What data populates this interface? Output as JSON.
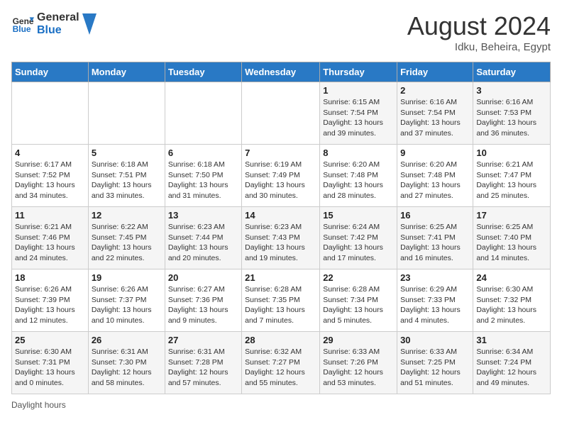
{
  "header": {
    "logo_line1": "General",
    "logo_line2": "Blue",
    "month_year": "August 2024",
    "location": "Idku, Beheira, Egypt"
  },
  "weekdays": [
    "Sunday",
    "Monday",
    "Tuesday",
    "Wednesday",
    "Thursday",
    "Friday",
    "Saturday"
  ],
  "weeks": [
    [
      {
        "day": "",
        "sunrise": "",
        "sunset": "",
        "daylight": ""
      },
      {
        "day": "",
        "sunrise": "",
        "sunset": "",
        "daylight": ""
      },
      {
        "day": "",
        "sunrise": "",
        "sunset": "",
        "daylight": ""
      },
      {
        "day": "",
        "sunrise": "",
        "sunset": "",
        "daylight": ""
      },
      {
        "day": "1",
        "sunrise": "6:15 AM",
        "sunset": "7:54 PM",
        "daylight": "13 hours and 39 minutes."
      },
      {
        "day": "2",
        "sunrise": "6:16 AM",
        "sunset": "7:54 PM",
        "daylight": "13 hours and 37 minutes."
      },
      {
        "day": "3",
        "sunrise": "6:16 AM",
        "sunset": "7:53 PM",
        "daylight": "13 hours and 36 minutes."
      }
    ],
    [
      {
        "day": "4",
        "sunrise": "6:17 AM",
        "sunset": "7:52 PM",
        "daylight": "13 hours and 34 minutes."
      },
      {
        "day": "5",
        "sunrise": "6:18 AM",
        "sunset": "7:51 PM",
        "daylight": "13 hours and 33 minutes."
      },
      {
        "day": "6",
        "sunrise": "6:18 AM",
        "sunset": "7:50 PM",
        "daylight": "13 hours and 31 minutes."
      },
      {
        "day": "7",
        "sunrise": "6:19 AM",
        "sunset": "7:49 PM",
        "daylight": "13 hours and 30 minutes."
      },
      {
        "day": "8",
        "sunrise": "6:20 AM",
        "sunset": "7:48 PM",
        "daylight": "13 hours and 28 minutes."
      },
      {
        "day": "9",
        "sunrise": "6:20 AM",
        "sunset": "7:48 PM",
        "daylight": "13 hours and 27 minutes."
      },
      {
        "day": "10",
        "sunrise": "6:21 AM",
        "sunset": "7:47 PM",
        "daylight": "13 hours and 25 minutes."
      }
    ],
    [
      {
        "day": "11",
        "sunrise": "6:21 AM",
        "sunset": "7:46 PM",
        "daylight": "13 hours and 24 minutes."
      },
      {
        "day": "12",
        "sunrise": "6:22 AM",
        "sunset": "7:45 PM",
        "daylight": "13 hours and 22 minutes."
      },
      {
        "day": "13",
        "sunrise": "6:23 AM",
        "sunset": "7:44 PM",
        "daylight": "13 hours and 20 minutes."
      },
      {
        "day": "14",
        "sunrise": "6:23 AM",
        "sunset": "7:43 PM",
        "daylight": "13 hours and 19 minutes."
      },
      {
        "day": "15",
        "sunrise": "6:24 AM",
        "sunset": "7:42 PM",
        "daylight": "13 hours and 17 minutes."
      },
      {
        "day": "16",
        "sunrise": "6:25 AM",
        "sunset": "7:41 PM",
        "daylight": "13 hours and 16 minutes."
      },
      {
        "day": "17",
        "sunrise": "6:25 AM",
        "sunset": "7:40 PM",
        "daylight": "13 hours and 14 minutes."
      }
    ],
    [
      {
        "day": "18",
        "sunrise": "6:26 AM",
        "sunset": "7:39 PM",
        "daylight": "13 hours and 12 minutes."
      },
      {
        "day": "19",
        "sunrise": "6:26 AM",
        "sunset": "7:37 PM",
        "daylight": "13 hours and 10 minutes."
      },
      {
        "day": "20",
        "sunrise": "6:27 AM",
        "sunset": "7:36 PM",
        "daylight": "13 hours and 9 minutes."
      },
      {
        "day": "21",
        "sunrise": "6:28 AM",
        "sunset": "7:35 PM",
        "daylight": "13 hours and 7 minutes."
      },
      {
        "day": "22",
        "sunrise": "6:28 AM",
        "sunset": "7:34 PM",
        "daylight": "13 hours and 5 minutes."
      },
      {
        "day": "23",
        "sunrise": "6:29 AM",
        "sunset": "7:33 PM",
        "daylight": "13 hours and 4 minutes."
      },
      {
        "day": "24",
        "sunrise": "6:30 AM",
        "sunset": "7:32 PM",
        "daylight": "13 hours and 2 minutes."
      }
    ],
    [
      {
        "day": "25",
        "sunrise": "6:30 AM",
        "sunset": "7:31 PM",
        "daylight": "13 hours and 0 minutes."
      },
      {
        "day": "26",
        "sunrise": "6:31 AM",
        "sunset": "7:30 PM",
        "daylight": "12 hours and 58 minutes."
      },
      {
        "day": "27",
        "sunrise": "6:31 AM",
        "sunset": "7:28 PM",
        "daylight": "12 hours and 57 minutes."
      },
      {
        "day": "28",
        "sunrise": "6:32 AM",
        "sunset": "7:27 PM",
        "daylight": "12 hours and 55 minutes."
      },
      {
        "day": "29",
        "sunrise": "6:33 AM",
        "sunset": "7:26 PM",
        "daylight": "12 hours and 53 minutes."
      },
      {
        "day": "30",
        "sunrise": "6:33 AM",
        "sunset": "7:25 PM",
        "daylight": "12 hours and 51 minutes."
      },
      {
        "day": "31",
        "sunrise": "6:34 AM",
        "sunset": "7:24 PM",
        "daylight": "12 hours and 49 minutes."
      }
    ]
  ],
  "footer": {
    "daylight_label": "Daylight hours"
  }
}
